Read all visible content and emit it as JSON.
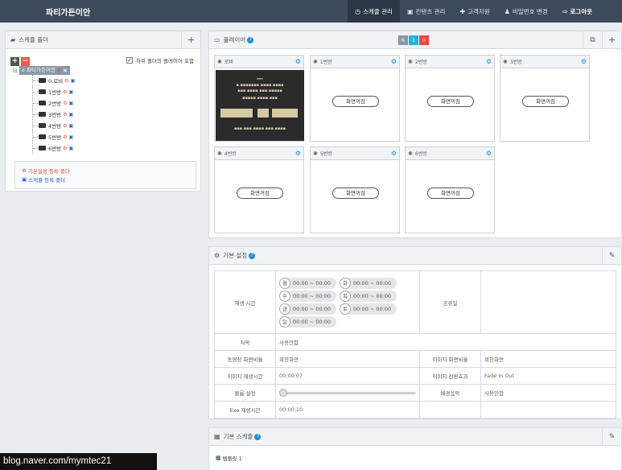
{
  "topbar": {
    "brand": "파티가든이안",
    "nav": [
      {
        "icon": "clock-icon",
        "glyph": "◷",
        "label": "스케쥴 관리",
        "active": true
      },
      {
        "icon": "image-icon",
        "glyph": "▣",
        "label": "컨텐츠 관리",
        "active": false
      },
      {
        "icon": "support-icon",
        "glyph": "✚",
        "label": "고객지원",
        "active": false
      },
      {
        "icon": "user-icon",
        "glyph": "♟",
        "label": "비밀번호 변경",
        "active": false
      },
      {
        "icon": "logout-icon",
        "glyph": "⇨",
        "label": "로그아웃",
        "active": false
      }
    ]
  },
  "folder_panel": {
    "title": "스케쥴 폴더",
    "include_sub_label": "하위 폴더의 플레이어 포함",
    "include_sub_checked": true,
    "root": "파티가든이안",
    "folders": [
      "0.로비",
      "1번방",
      "2번방",
      "3번방",
      "4번방",
      "5번방",
      "6번방"
    ],
    "legend": {
      "config": "기본설정 등록 폴더",
      "schedule": "스케쥴 등록 폴더"
    }
  },
  "player_panel": {
    "title": "플레이어",
    "badges": [
      {
        "value": "6",
        "color": "#8a96a6"
      },
      {
        "value": "1",
        "color": "#1fb5d6"
      },
      {
        "value": "0",
        "color": "#e8493a"
      }
    ],
    "players": [
      {
        "name": "로비",
        "state": "playing"
      },
      {
        "name": "1번방",
        "state": "화면꺼짐"
      },
      {
        "name": "2번방",
        "state": "화면꺼짐"
      },
      {
        "name": "3번방",
        "state": "화면꺼짐"
      },
      {
        "name": "4번방",
        "state": "화면꺼짐"
      },
      {
        "name": "5번방",
        "state": "화면꺼짐"
      },
      {
        "name": "6번방",
        "state": "화면꺼짐"
      }
    ]
  },
  "settings_panel": {
    "title": "기본 설정",
    "play_time_label": "재생 시간",
    "days": [
      {
        "day": "월",
        "time": "00:00 ~ 00:00"
      },
      {
        "day": "화",
        "time": "00:00 ~ 00:00"
      },
      {
        "day": "수",
        "time": "00:00 ~ 00:00"
      },
      {
        "day": "목",
        "time": "00:00 ~ 00:00"
      },
      {
        "day": "금",
        "time": "00:00 ~ 00:00"
      },
      {
        "day": "토",
        "time": "00:00 ~ 00:00"
      },
      {
        "day": "일",
        "time": "00:00 ~ 00:00"
      }
    ],
    "holiday_label": "공휴일",
    "subtitle_label": "자막",
    "subtitle_value": "사용안함",
    "video_ratio_label": "동영상 화면비율",
    "video_ratio_value": "꽉찬화면",
    "image_ratio_label": "이미지 화면비율",
    "image_ratio_value": "꽉찬화면",
    "image_time_label": "이미지 재생시간",
    "image_time_value": "00:00:07",
    "image_effect_label": "이미지 전환효과",
    "image_effect_value": "Fade In Out",
    "volume_label": "볼륨 설정",
    "volume_level": 0,
    "bgm_label": "배경음악",
    "bgm_value": "사용안함",
    "exe_label": "Exe 재생시간",
    "exe_value": "00:00:10"
  },
  "schedule_panel": {
    "title": "기본 스케쥴",
    "template": "템플릿 1"
  },
  "watermark": "blog.naver.com/mymtec21"
}
